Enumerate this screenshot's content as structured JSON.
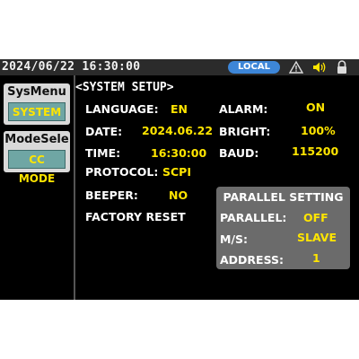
{
  "status_bar": {
    "datetime": "2024/06/22 16:30:00",
    "mode_badge": "LOCAL",
    "icons": [
      "warning-icon",
      "speaker-icon",
      "lock-icon"
    ]
  },
  "sidebar": {
    "sys_menu": {
      "title": "SysMenu",
      "button": "SYSTEM"
    },
    "mode_select": {
      "title": "ModeSele",
      "button": "CC MODE"
    }
  },
  "system_setup": {
    "title": "<SYSTEM SETUP>",
    "language": {
      "label": "LANGUAGE:",
      "value": "EN"
    },
    "alarm": {
      "label": "ALARM:",
      "value": "ON"
    },
    "date": {
      "label": "DATE:",
      "value": "2024.06.22"
    },
    "bright": {
      "label": "BRIGHT:",
      "value": "100%"
    },
    "time": {
      "label": "TIME:",
      "value": "16:30:00"
    },
    "baud": {
      "label": "BAUD:",
      "value": "115200"
    },
    "protocol": {
      "label": "PROTOCOL:",
      "value": "SCPI"
    },
    "beeper": {
      "label": "BEEPER:",
      "value": "NO"
    },
    "factory_reset": {
      "label": "FACTORY RESET"
    }
  },
  "parallel_setting": {
    "title": "PARALLEL SETTING",
    "parallel": {
      "label": "PARALLEL:",
      "value": "OFF"
    },
    "ms": {
      "label": "M/S:",
      "value": "SLAVE"
    },
    "address": {
      "label": "ADDRESS:",
      "value": "1"
    }
  },
  "colors": {
    "screen_bg": "#000000",
    "status_bar_bg": "#2b2b2b",
    "badge_blue": "#3d86d8",
    "value_yellow": "#ffe500",
    "menu_button_teal": "#6fa6a4",
    "panel_gray": "#6b6b6b"
  }
}
